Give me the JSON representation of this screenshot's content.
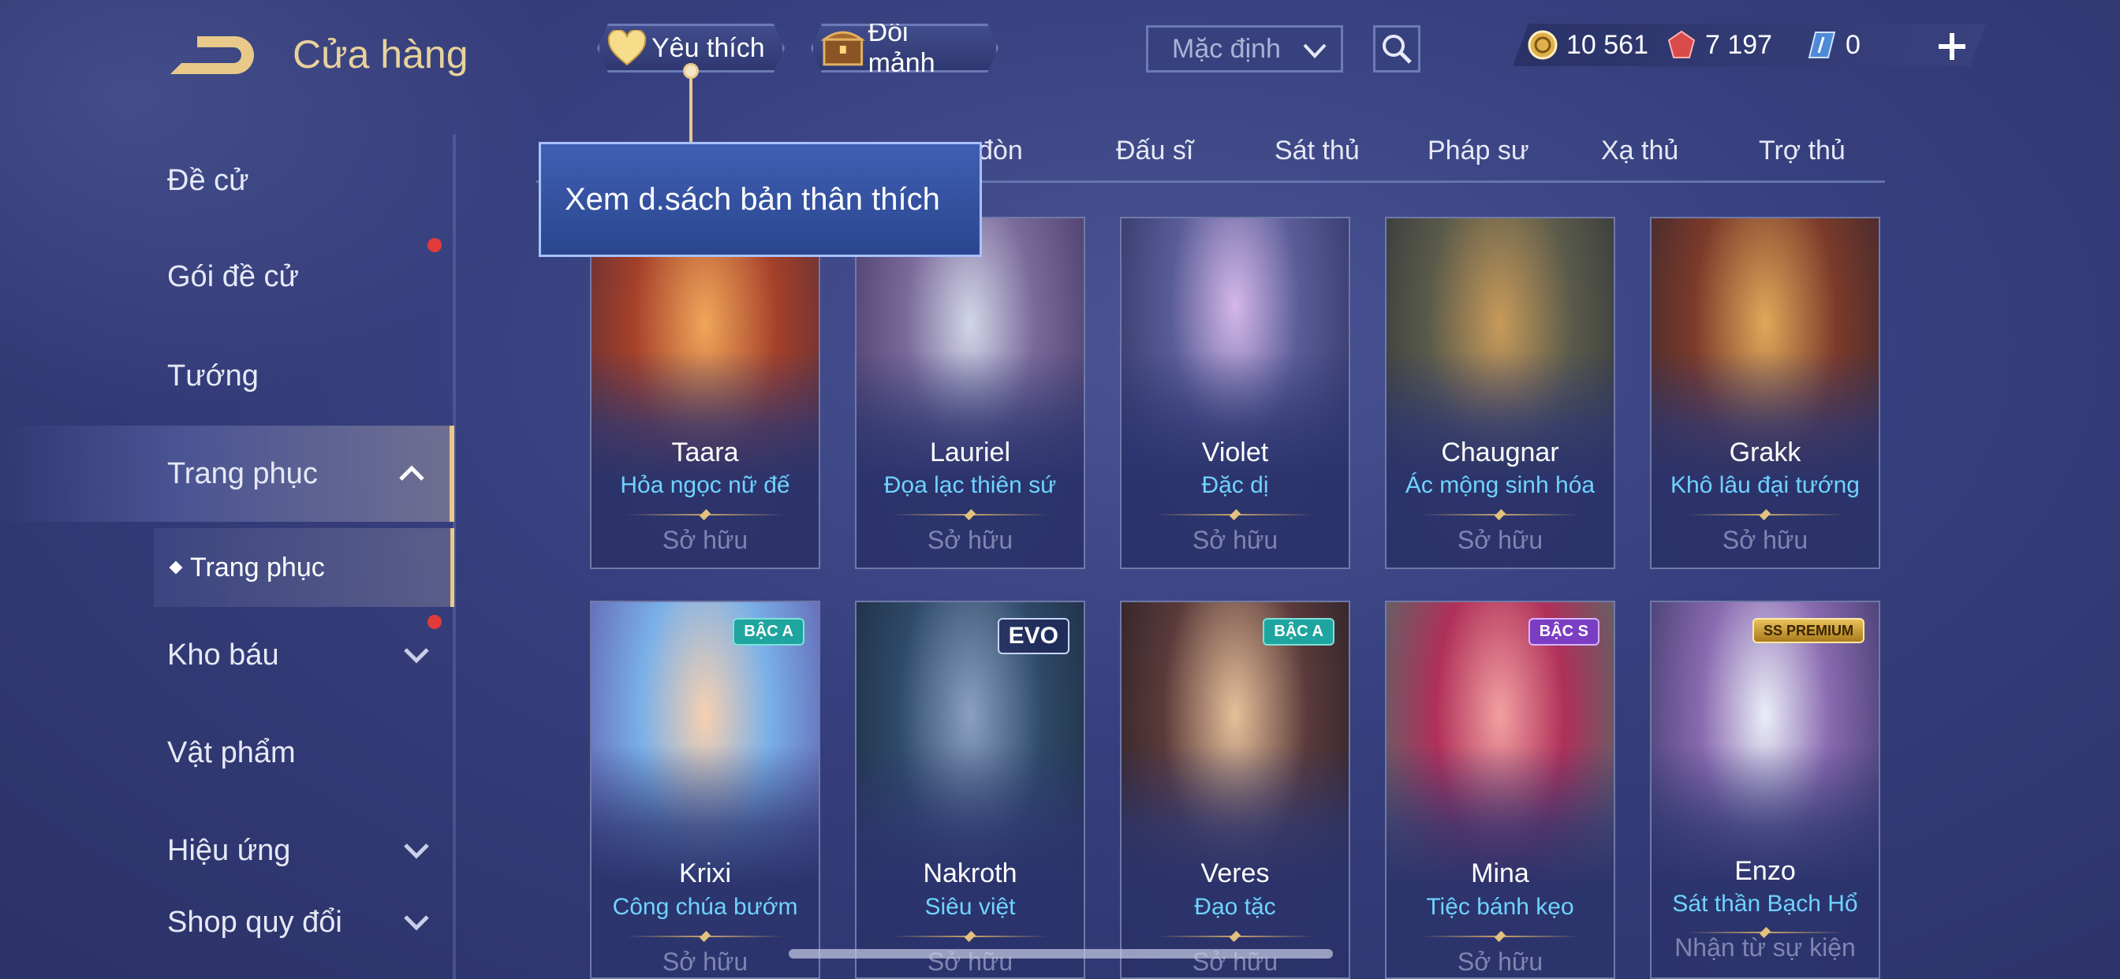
{
  "header": {
    "title": "Cửa hàng",
    "favorites_label": "Yêu thích",
    "fragments_label": "Đổi mảnh",
    "sort_value": "Mặc định"
  },
  "currencies": {
    "gold": "10 561",
    "red": "7 197",
    "blue": "0"
  },
  "tooltip": "Xem d.sách bản thân thích",
  "sidebar": {
    "items": [
      {
        "label": "Đề cử"
      },
      {
        "label": "Gói đề cử"
      },
      {
        "label": "Tướng"
      },
      {
        "label": "Trang phục"
      },
      {
        "label": "Trang phục"
      },
      {
        "label": "Kho báu"
      },
      {
        "label": "Vật phẩm"
      },
      {
        "label": "Hiệu ứng"
      },
      {
        "label": "Shop quy đổi"
      }
    ]
  },
  "tabs": [
    {
      "label": "đòn"
    },
    {
      "label": "Đấu sĩ"
    },
    {
      "label": "Sát thủ"
    },
    {
      "label": "Pháp sư"
    },
    {
      "label": "Xạ thủ"
    },
    {
      "label": "Trợ thủ"
    }
  ],
  "cards": [
    {
      "hero": "Taara",
      "skin": "Hỏa ngọc nữ đế",
      "status": "Sở hữu"
    },
    {
      "hero": "Lauriel",
      "skin": "Đọa lạc thiên sứ",
      "status": "Sở hữu"
    },
    {
      "hero": "Violet",
      "skin": "Đặc dị",
      "status": "Sở hữu"
    },
    {
      "hero": "Chaugnar",
      "skin": "Ác mộng sinh hóa",
      "status": "Sở hữu"
    },
    {
      "hero": "Grakk",
      "skin": "Khô lâu đại tướng",
      "status": "Sở hữu"
    },
    {
      "hero": "Krixi",
      "skin": "Công chúa bướm",
      "status": "Sở hữu",
      "badge": "BẬC A"
    },
    {
      "hero": "Nakroth",
      "skin": "Siêu việt",
      "status": "Sở hữu",
      "badge": "EVO"
    },
    {
      "hero": "Veres",
      "skin": "Đạo tặc",
      "status": "Sở hữu",
      "badge": "BẬC A"
    },
    {
      "hero": "Mina",
      "skin": "Tiệc bánh kẹo",
      "status": "Sở hữu",
      "badge": "BẬC S"
    },
    {
      "hero": "Enzo",
      "skin": "Sát thần Bạch Hổ",
      "status": "Nhận từ sự kiện",
      "badge": "SS PREMIUM"
    }
  ],
  "colors": {
    "accent_gold": "#e8c98a",
    "skin_name": "#6fd3ff",
    "owned_text": "#7e86b0",
    "notification": "#e23a3a"
  },
  "icons": [
    "back-icon",
    "heart-icon",
    "chest-icon",
    "chevron-down-icon",
    "search-icon",
    "gold-coin-icon",
    "red-gem-icon",
    "blue-voucher-icon",
    "plus-icon",
    "chevron-up-icon"
  ]
}
